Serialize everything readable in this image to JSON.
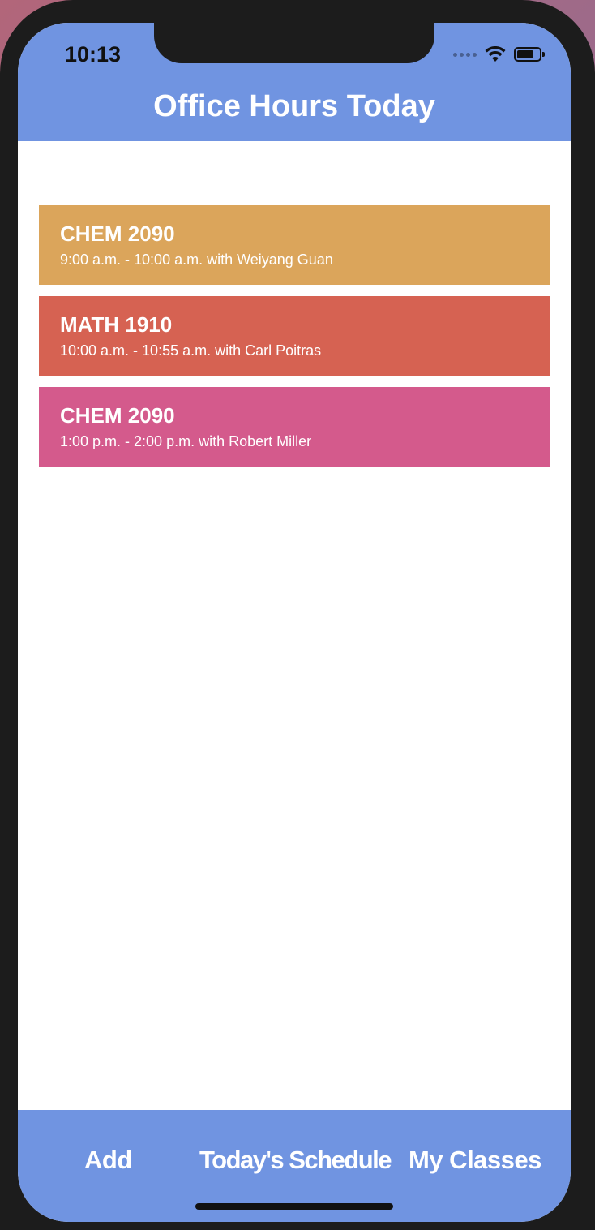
{
  "status_bar": {
    "time": "10:13"
  },
  "header": {
    "title": "Office Hours Today"
  },
  "office_hours": [
    {
      "course": "CHEM 2090",
      "details": "9:00 a.m. - 10:00 a.m. with Weiyang Guan",
      "color": "#dba55b"
    },
    {
      "course": "MATH 1910",
      "details": "10:00 a.m. - 10:55 a.m. with Carl Poitras",
      "color": "#d66252"
    },
    {
      "course": "CHEM 2090",
      "details": "1:00 p.m. - 2:00 p.m. with Robert Miller",
      "color": "#d45a8c"
    }
  ],
  "tab_bar": {
    "add_label": "Add",
    "today_label": "Today's Schedule",
    "classes_label": "My Classes"
  },
  "colors": {
    "accent": "#7094e1"
  },
  "icons": {
    "signal": "cellular-signal-icon",
    "wifi": "wifi-icon",
    "battery": "battery-icon"
  }
}
